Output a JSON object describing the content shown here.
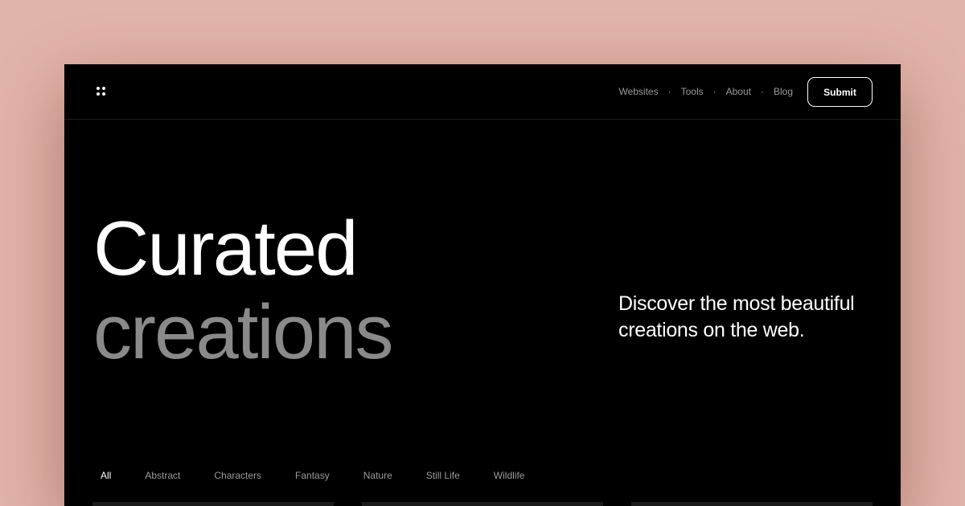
{
  "header": {
    "logo_icon": "four-dots-icon",
    "nav": [
      {
        "label": "Websites"
      },
      {
        "label": "Tools"
      },
      {
        "label": "About"
      },
      {
        "label": "Blog"
      }
    ],
    "nav_separator": "·",
    "submit_label": "Submit"
  },
  "hero": {
    "title_line1": "Curated",
    "title_line2": "creations",
    "tagline": "Discover the most beautiful creations on the web."
  },
  "filters": {
    "active": "All",
    "items": [
      {
        "label": "All"
      },
      {
        "label": "Abstract"
      },
      {
        "label": "Characters"
      },
      {
        "label": "Fantasy"
      },
      {
        "label": "Nature"
      },
      {
        "label": "Still Life"
      },
      {
        "label": "Wildlife"
      }
    ]
  },
  "colors": {
    "background": "#e2b3a8",
    "surface": "#000000",
    "text_primary": "#ffffff",
    "text_muted": "#8a8a8a"
  }
}
